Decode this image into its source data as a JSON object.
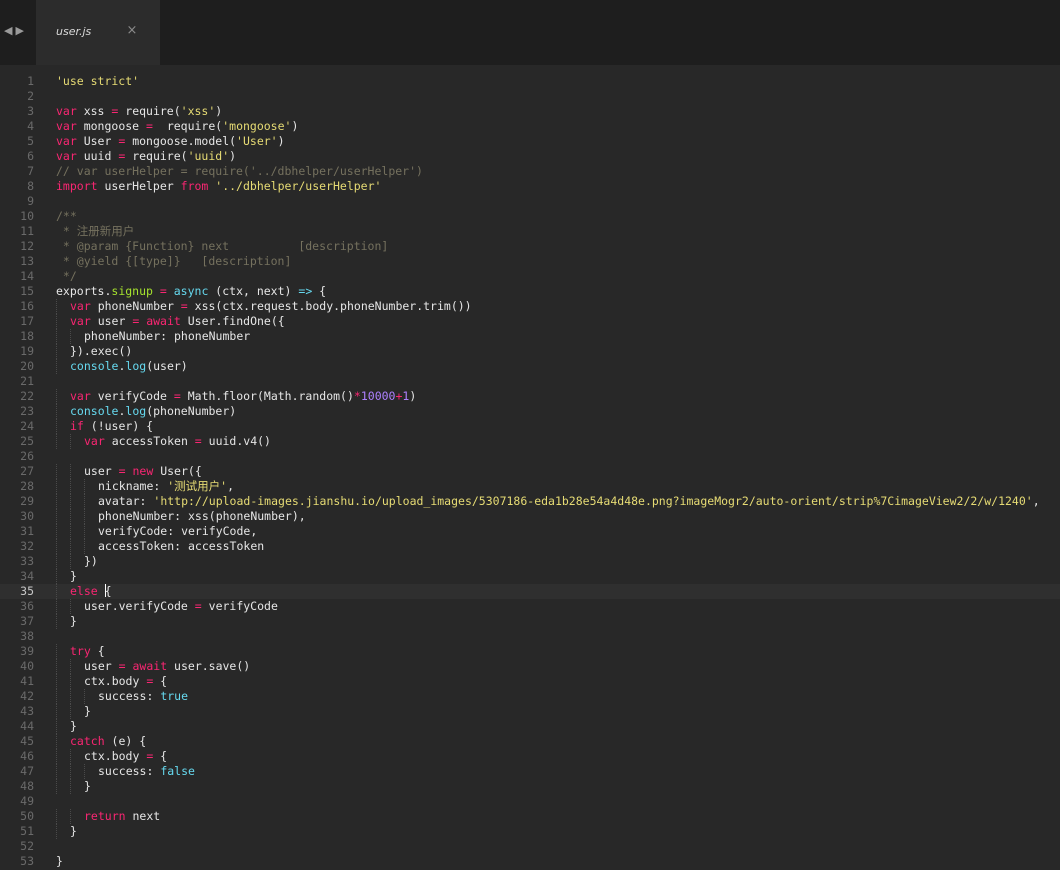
{
  "tab": {
    "filename": "user.js",
    "close_glyph": "×"
  },
  "nav": {
    "back_glyph": "◀",
    "forward_glyph": "▶"
  },
  "editor": {
    "current_line": 35,
    "caret_line": 35,
    "lines": [
      {
        "n": "1",
        "indent": 0,
        "tokens": [
          [
            "str",
            "'use strict'"
          ]
        ]
      },
      {
        "n": "2",
        "indent": 0,
        "tokens": []
      },
      {
        "n": "3",
        "indent": 0,
        "tokens": [
          [
            "kw",
            "var"
          ],
          [
            "plain",
            " xss "
          ],
          [
            "op",
            "="
          ],
          [
            "plain",
            " require("
          ],
          [
            "str",
            "'xss'"
          ],
          [
            "plain",
            ")"
          ]
        ]
      },
      {
        "n": "4",
        "indent": 0,
        "tokens": [
          [
            "kw",
            "var"
          ],
          [
            "plain",
            " mongoose "
          ],
          [
            "op",
            "="
          ],
          [
            "plain",
            "  require("
          ],
          [
            "str",
            "'mongoose'"
          ],
          [
            "plain",
            ")"
          ]
        ]
      },
      {
        "n": "5",
        "indent": 0,
        "tokens": [
          [
            "kw",
            "var"
          ],
          [
            "plain",
            " User "
          ],
          [
            "op",
            "="
          ],
          [
            "plain",
            " mongoose.model("
          ],
          [
            "str",
            "'User'"
          ],
          [
            "plain",
            ")"
          ]
        ]
      },
      {
        "n": "6",
        "indent": 0,
        "tokens": [
          [
            "kw",
            "var"
          ],
          [
            "plain",
            " uuid "
          ],
          [
            "op",
            "="
          ],
          [
            "plain",
            " require("
          ],
          [
            "str",
            "'uuid'"
          ],
          [
            "plain",
            ")"
          ]
        ]
      },
      {
        "n": "7",
        "indent": 0,
        "tokens": [
          [
            "cm",
            "// var userHelper = require('../dbhelper/userHelper')"
          ]
        ]
      },
      {
        "n": "8",
        "indent": 0,
        "tokens": [
          [
            "kw",
            "import"
          ],
          [
            "plain",
            " userHelper "
          ],
          [
            "kw",
            "from"
          ],
          [
            "plain",
            " "
          ],
          [
            "str",
            "'../dbhelper/userHelper'"
          ]
        ]
      },
      {
        "n": "9",
        "indent": 0,
        "tokens": []
      },
      {
        "n": "10",
        "indent": 0,
        "tokens": [
          [
            "cm",
            "/**"
          ]
        ]
      },
      {
        "n": "11",
        "indent": 0,
        "tokens": [
          [
            "cm",
            " * 注册新用户"
          ]
        ]
      },
      {
        "n": "12",
        "indent": 0,
        "tokens": [
          [
            "cm",
            " * @param {Function} next          [description]"
          ]
        ]
      },
      {
        "n": "13",
        "indent": 0,
        "tokens": [
          [
            "cm",
            " * @yield {[type]}   [description]"
          ]
        ]
      },
      {
        "n": "14",
        "indent": 0,
        "tokens": [
          [
            "cm",
            " */"
          ]
        ]
      },
      {
        "n": "15",
        "indent": 0,
        "tokens": [
          [
            "plain",
            "exports."
          ],
          [
            "prop",
            "signup"
          ],
          [
            "plain",
            " "
          ],
          [
            "op",
            "="
          ],
          [
            "plain",
            " "
          ],
          [
            "var",
            "async"
          ],
          [
            "plain",
            " (ctx, next) "
          ],
          [
            "var",
            "=>"
          ],
          [
            "plain",
            " {"
          ]
        ]
      },
      {
        "n": "16",
        "indent": 1,
        "tokens": [
          [
            "kw",
            "var"
          ],
          [
            "plain",
            " phoneNumber "
          ],
          [
            "op",
            "="
          ],
          [
            "plain",
            " xss(ctx.request.body.phoneNumber.trim())"
          ]
        ]
      },
      {
        "n": "17",
        "indent": 1,
        "tokens": [
          [
            "kw",
            "var"
          ],
          [
            "plain",
            " user "
          ],
          [
            "op",
            "="
          ],
          [
            "plain",
            " "
          ],
          [
            "kw",
            "await"
          ],
          [
            "plain",
            " User.findOne({"
          ]
        ]
      },
      {
        "n": "18",
        "indent": 2,
        "tokens": [
          [
            "plain",
            "phoneNumber: phoneNumber"
          ]
        ]
      },
      {
        "n": "19",
        "indent": 1,
        "tokens": [
          [
            "plain",
            "}).exec()"
          ]
        ]
      },
      {
        "n": "20",
        "indent": 1,
        "tokens": [
          [
            "var",
            "console"
          ],
          [
            "plain",
            "."
          ],
          [
            "var",
            "log"
          ],
          [
            "plain",
            "(user)"
          ]
        ]
      },
      {
        "n": "21",
        "indent": 0,
        "tokens": []
      },
      {
        "n": "22",
        "indent": 1,
        "tokens": [
          [
            "kw",
            "var"
          ],
          [
            "plain",
            " verifyCode "
          ],
          [
            "op",
            "="
          ],
          [
            "plain",
            " Math.floor(Math.random()"
          ],
          [
            "op",
            "*"
          ],
          [
            "num",
            "10000"
          ],
          [
            "op",
            "+"
          ],
          [
            "num",
            "1"
          ],
          [
            "plain",
            ")"
          ]
        ]
      },
      {
        "n": "23",
        "indent": 1,
        "tokens": [
          [
            "var",
            "console"
          ],
          [
            "plain",
            "."
          ],
          [
            "var",
            "log"
          ],
          [
            "plain",
            "(phoneNumber)"
          ]
        ]
      },
      {
        "n": "24",
        "indent": 1,
        "tokens": [
          [
            "kw",
            "if"
          ],
          [
            "plain",
            " (!user) {"
          ]
        ]
      },
      {
        "n": "25",
        "indent": 2,
        "tokens": [
          [
            "kw",
            "var"
          ],
          [
            "plain",
            " accessToken "
          ],
          [
            "op",
            "="
          ],
          [
            "plain",
            " uuid.v4()"
          ]
        ]
      },
      {
        "n": "26",
        "indent": 0,
        "tokens": []
      },
      {
        "n": "27",
        "indent": 2,
        "tokens": [
          [
            "plain",
            "user "
          ],
          [
            "op",
            "="
          ],
          [
            "plain",
            " "
          ],
          [
            "kw",
            "new"
          ],
          [
            "plain",
            " User({"
          ]
        ]
      },
      {
        "n": "28",
        "indent": 3,
        "tokens": [
          [
            "plain",
            "nickname: "
          ],
          [
            "str",
            "'测试用户'"
          ],
          [
            "plain",
            ","
          ]
        ]
      },
      {
        "n": "29",
        "indent": 3,
        "tokens": [
          [
            "plain",
            "avatar: "
          ],
          [
            "str",
            "'http://upload-images.jianshu.io/upload_images/5307186-eda1b28e54a4d48e.png?imageMogr2/auto-orient/strip%7CimageView2/2/w/1240'"
          ],
          [
            "plain",
            ","
          ]
        ]
      },
      {
        "n": "30",
        "indent": 3,
        "tokens": [
          [
            "plain",
            "phoneNumber: xss(phoneNumber),"
          ]
        ]
      },
      {
        "n": "31",
        "indent": 3,
        "tokens": [
          [
            "plain",
            "verifyCode: verifyCode,"
          ]
        ]
      },
      {
        "n": "32",
        "indent": 3,
        "tokens": [
          [
            "plain",
            "accessToken: accessToken"
          ]
        ]
      },
      {
        "n": "33",
        "indent": 2,
        "tokens": [
          [
            "plain",
            "})"
          ]
        ]
      },
      {
        "n": "34",
        "indent": 1,
        "tokens": [
          [
            "plain",
            "}"
          ]
        ]
      },
      {
        "n": "35",
        "indent": 1,
        "tokens": [
          [
            "kw",
            "else"
          ],
          [
            "plain",
            " {"
          ]
        ]
      },
      {
        "n": "36",
        "indent": 2,
        "tokens": [
          [
            "plain",
            "user.verifyCode "
          ],
          [
            "op",
            "="
          ],
          [
            "plain",
            " verifyCode"
          ]
        ]
      },
      {
        "n": "37",
        "indent": 1,
        "tokens": [
          [
            "plain",
            "}"
          ]
        ]
      },
      {
        "n": "38",
        "indent": 0,
        "tokens": []
      },
      {
        "n": "39",
        "indent": 1,
        "tokens": [
          [
            "kw",
            "try"
          ],
          [
            "plain",
            " {"
          ]
        ]
      },
      {
        "n": "40",
        "indent": 2,
        "tokens": [
          [
            "plain",
            "user "
          ],
          [
            "op",
            "="
          ],
          [
            "plain",
            " "
          ],
          [
            "kw",
            "await"
          ],
          [
            "plain",
            " user.save()"
          ]
        ]
      },
      {
        "n": "41",
        "indent": 2,
        "tokens": [
          [
            "plain",
            "ctx.body "
          ],
          [
            "op",
            "="
          ],
          [
            "plain",
            " {"
          ]
        ]
      },
      {
        "n": "42",
        "indent": 3,
        "tokens": [
          [
            "plain",
            "success: "
          ],
          [
            "const",
            "true"
          ]
        ]
      },
      {
        "n": "43",
        "indent": 2,
        "tokens": [
          [
            "plain",
            "}"
          ]
        ]
      },
      {
        "n": "44",
        "indent": 1,
        "tokens": [
          [
            "plain",
            "}"
          ]
        ]
      },
      {
        "n": "45",
        "indent": 1,
        "tokens": [
          [
            "kw",
            "catch"
          ],
          [
            "plain",
            " (e) {"
          ]
        ]
      },
      {
        "n": "46",
        "indent": 2,
        "tokens": [
          [
            "plain",
            "ctx.body "
          ],
          [
            "op",
            "="
          ],
          [
            "plain",
            " {"
          ]
        ]
      },
      {
        "n": "47",
        "indent": 3,
        "tokens": [
          [
            "plain",
            "success: "
          ],
          [
            "const",
            "false"
          ]
        ]
      },
      {
        "n": "48",
        "indent": 2,
        "tokens": [
          [
            "plain",
            "}"
          ]
        ]
      },
      {
        "n": "49",
        "indent": 0,
        "tokens": []
      },
      {
        "n": "50",
        "indent": 2,
        "tokens": [
          [
            "kw",
            "return"
          ],
          [
            "plain",
            " next"
          ]
        ]
      },
      {
        "n": "51",
        "indent": 1,
        "tokens": [
          [
            "plain",
            "}"
          ]
        ]
      },
      {
        "n": "52",
        "indent": 0,
        "tokens": []
      },
      {
        "n": "53",
        "indent": 0,
        "tokens": [
          [
            "plain",
            "}"
          ]
        ]
      }
    ]
  }
}
